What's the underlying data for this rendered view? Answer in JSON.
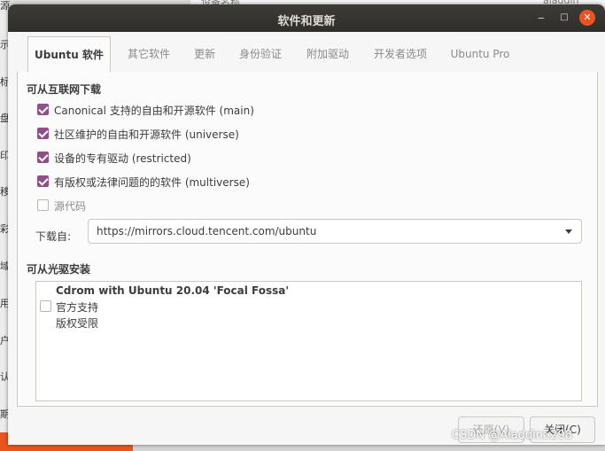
{
  "background": {
    "left_chars": [
      "源",
      "示",
      "标",
      "盘",
      "印",
      "移",
      "彩",
      "域",
      "用",
      "户",
      "认",
      "期"
    ],
    "top_left_text": "设备名称",
    "top_right_text": "aladdin"
  },
  "window": {
    "title": "软件和更新",
    "minimize_glyph": "‒",
    "maximize_glyph": "□",
    "close_glyph": "✕"
  },
  "tabs": [
    {
      "label": "Ubuntu 软件",
      "active": true
    },
    {
      "label": "其它软件",
      "active": false
    },
    {
      "label": "更新",
      "active": false
    },
    {
      "label": "身份验证",
      "active": false
    },
    {
      "label": "附加驱动",
      "active": false
    },
    {
      "label": "开发者选项",
      "active": false
    },
    {
      "label": "Ubuntu Pro",
      "active": false
    }
  ],
  "internet": {
    "section_title": "可从互联网下载",
    "options": [
      {
        "label": "Canonical 支持的自由和开源软件 (main)",
        "checked": true
      },
      {
        "label": "社区维护的自由和开源软件 (universe)",
        "checked": true
      },
      {
        "label": "设备的专有驱动 (restricted)",
        "checked": true
      },
      {
        "label": "有版权或法律问题的的软件 (multiverse)",
        "checked": true
      },
      {
        "label": "源代码",
        "checked": false
      }
    ],
    "download_from_label": "下载自:",
    "download_from_value": "https://mirrors.cloud.tencent.com/ubuntu"
  },
  "cdrom": {
    "section_title": "可从光驱安装",
    "entry": {
      "name": "Cdrom with Ubuntu 20.04 'Focal Fossa'",
      "line2": "官方支持",
      "line3": "版权受限",
      "checked": false
    }
  },
  "buttons": {
    "revert": "还原(V)",
    "close": "关闭(C)"
  },
  "watermark": "CSDN @Aladdin5298",
  "colors": {
    "checkbox_accent": "#924d8b",
    "titlebar": "#3c3b37",
    "close_button": "#e95420"
  }
}
